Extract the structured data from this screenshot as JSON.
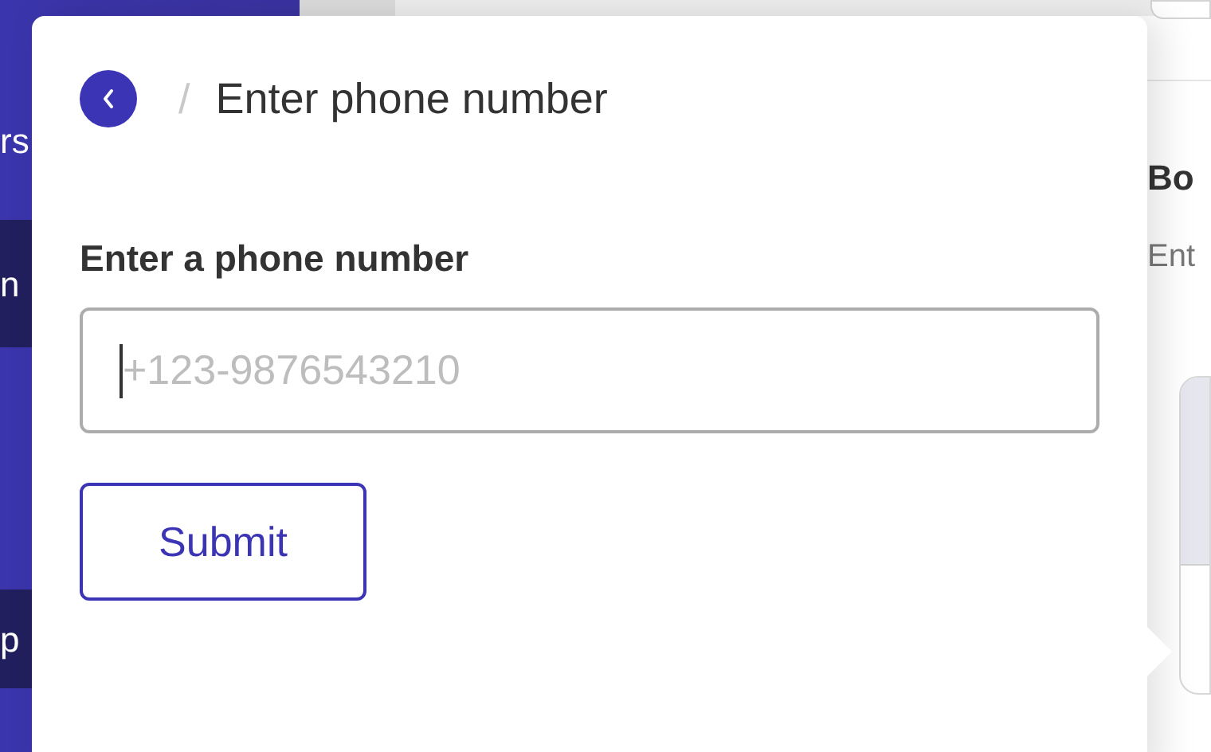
{
  "sidebar": {
    "items": [
      {
        "label": "rs",
        "selected": false
      },
      {
        "label": "n",
        "selected": true
      },
      {
        "label": "p",
        "selected": true
      }
    ]
  },
  "main": {
    "heading": "Bo",
    "subheading": "Ent"
  },
  "popover": {
    "separator": "/",
    "title": "Enter phone number",
    "field_label": "Enter a phone number",
    "phone_field": {
      "placeholder": "+123-9876543210"
    },
    "submit_button": "Submit"
  }
}
